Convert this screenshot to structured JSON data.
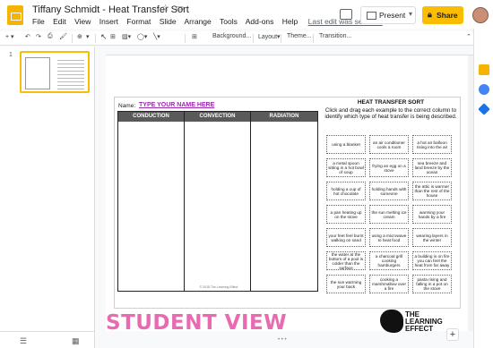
{
  "app": {
    "title": "Tiffany Schmidt - Heat Transfer Sort",
    "menus": [
      "File",
      "Edit",
      "View",
      "Insert",
      "Format",
      "Slide",
      "Arrange",
      "Tools",
      "Add-ons",
      "Help"
    ],
    "last_edit": "Last edit was secon…",
    "present_label": "Present",
    "share_label": "Share",
    "share_icon": "lock-icon"
  },
  "toolbar": {
    "zoom": "⊕",
    "background_label": "Background...",
    "layout_label": "Layout▾",
    "theme_label": "Theme...",
    "transition_label": "Transition..."
  },
  "filmstrip": {
    "slide_number": "1"
  },
  "slide": {
    "name_label": "Name:",
    "name_value": "TYPE YOUR NAME HERE",
    "columns": [
      "CONDUCTION",
      "CONVECTION",
      "RADIATION"
    ],
    "copyright": "© 2018 The Learning Effect",
    "sort_title": "HEAT TRANSFER SORT",
    "instructions": "Click and drag each example to the correct column to identify which type of heat transfer is being described.",
    "cards": [
      "using a blanket",
      "an air conditioner cools a room",
      "a hot air balloon rising into the air",
      "a metal spoon sitting in a hot bowl of soup",
      "frying an egg on a stove",
      "sea breeze and land breeze by the ocean",
      "holding a cup of hot chocolate",
      "holding hands with someone",
      "the attic is warmer than the rest of the house",
      "a pan heating up on the stove",
      "the sun melting ice cream",
      "warming your hands by a fire",
      "your feet feel burnt walking on sand",
      "using a microwave to heat food",
      "wearing layers in the winter",
      "the water at the bottom of a pool is colder than the surface",
      "a charcoal grill cooking hamburgers",
      "a building is on fire you can feel the heat from far away",
      "the sun warming your back",
      "cooking a marshmallow over a fire",
      "pasta rising and falling in a pot on the stove"
    ]
  },
  "footer": {
    "student_view": "STUDENT VIEW",
    "brand_line1": "THE",
    "brand_line2": "LEARNING",
    "brand_line3": "EFFECT"
  },
  "colors": {
    "share": "#fbbc04",
    "student_view": "#e86ab0",
    "name_value": "#9c27b0",
    "column_header": "#5a5a5a"
  }
}
